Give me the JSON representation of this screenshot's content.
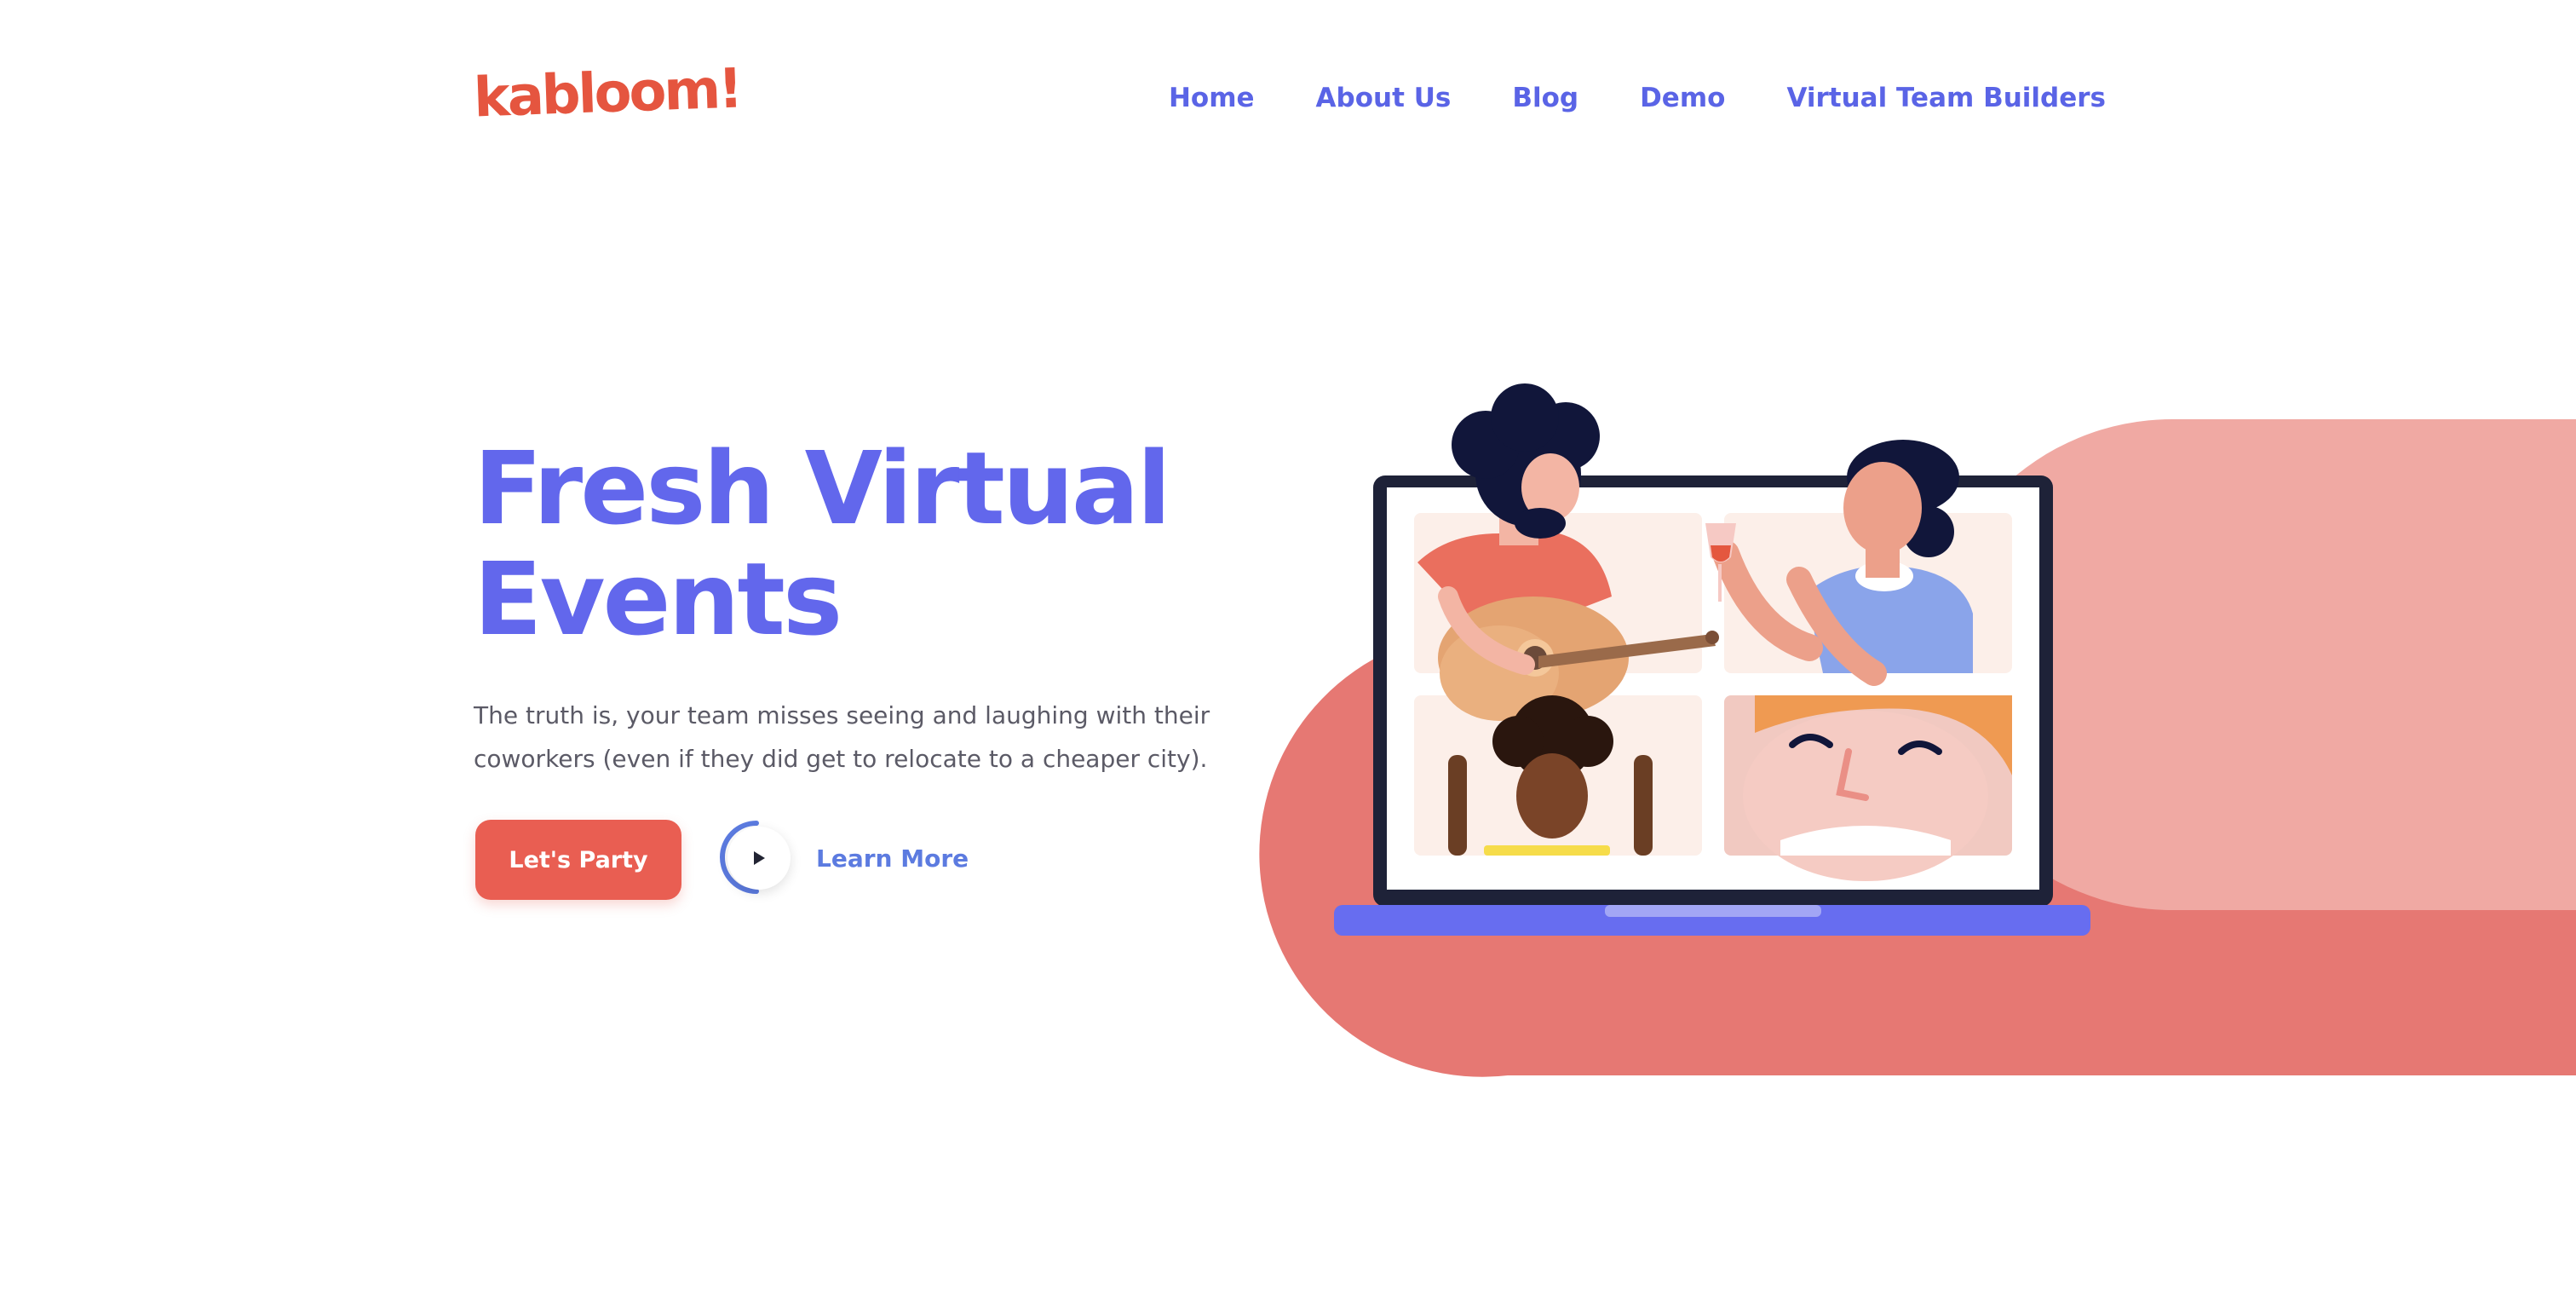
{
  "brand": {
    "logo_text": "kabloom!",
    "color": "#e5553f"
  },
  "nav": {
    "items": [
      {
        "label": "Home"
      },
      {
        "label": "About Us"
      },
      {
        "label": "Blog"
      },
      {
        "label": "Demo"
      },
      {
        "label": "Virtual Team Builders"
      }
    ],
    "color": "#5a64e6"
  },
  "hero": {
    "title_lines": [
      "Fresh Virtual",
      "Events"
    ],
    "description_lines": [
      "The truth is, your team misses seeing and laughing with their",
      "coworkers (even if they did get to relocate to a cheaper city)."
    ],
    "primary_button": "Let's Party",
    "secondary_link": "Learn More",
    "title_color": "#6267ec",
    "button_color": "#e95e52"
  },
  "illustration": {
    "subject": "laptop video call with four people",
    "icons": [
      "laptop-icon",
      "play-icon"
    ],
    "blob_colors": [
      "#e67873",
      "#f0a9a3"
    ]
  }
}
